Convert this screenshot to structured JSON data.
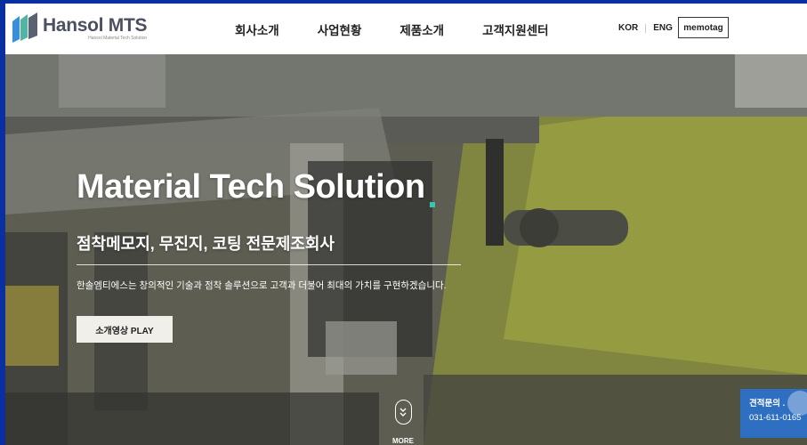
{
  "header": {
    "logo": {
      "title": "Hansol MTS",
      "subtitle": "Hansol Material Tech Solution",
      "icon": "hansol-logo-icon"
    },
    "nav": [
      {
        "label": "회사소개"
      },
      {
        "label": "사업현황"
      },
      {
        "label": "제품소개"
      },
      {
        "label": "고객지원센터"
      }
    ],
    "lang": {
      "kor": "KOR",
      "eng": "ENG"
    },
    "memotag": "memotag"
  },
  "hero": {
    "title": "Material Tech Solution",
    "subtitle": "점착메모지, 무진지, 코팅 전문제조회사",
    "description": "한솔엠티에스는 창의적인 기술과 점착 솔루션으로 고객과 더불어 최대의 가치를 구현하겠습니다.",
    "play_button": "소개영상 PLAY",
    "more_label": "MORE",
    "accent_color": "#36c6b0"
  },
  "quote": {
    "title": "견적문의 .",
    "phone": "031-611-0165",
    "color": "#2f6fc2"
  },
  "colors": {
    "frame": "#0a2fa0",
    "header_bg": "#ffffff"
  }
}
